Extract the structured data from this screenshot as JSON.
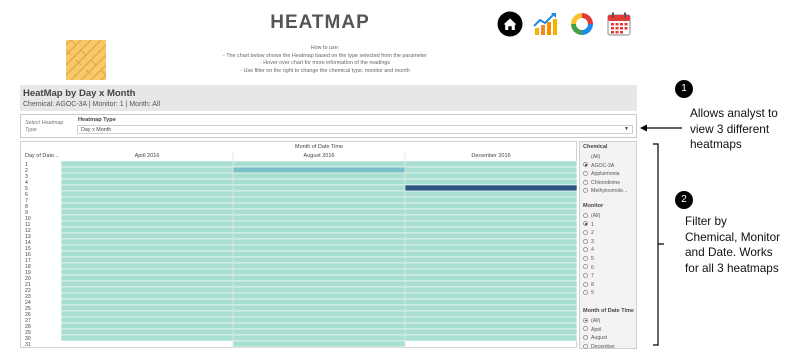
{
  "page": {
    "title": "HEATMAP",
    "how_to": [
      "How to use:",
      "- The chart below shows the  Heatmap based on the type selected from the parameter",
      "- Hover over chart for more information of the readings",
      "- Use filter on the right to change the chemical type, monitor and month"
    ]
  },
  "nav_icons": [
    "home-icon",
    "trend-chart-icon",
    "cycle-icon",
    "calendar-icon"
  ],
  "header": {
    "title": "HeatMap by Day x Month",
    "subtitle": "Chemical: AGOC-3A | Monitor: 1 | Month: All"
  },
  "parameter": {
    "side_label": [
      "Select Heatmap",
      "Type"
    ],
    "label": "Heatmap Type",
    "value": "Day x Month"
  },
  "chart": {
    "top_title": "Month of Date Time",
    "row_title": "Day of Date...",
    "columns": [
      "April 2016",
      "August 2016",
      "December 2016"
    ],
    "days": [
      "1",
      "2",
      "3",
      "4",
      "5",
      "6",
      "7",
      "8",
      "9",
      "10",
      "11",
      "12",
      "13",
      "14",
      "15",
      "16",
      "17",
      "18",
      "19",
      "20",
      "21",
      "22",
      "23",
      "24",
      "25",
      "26",
      "27",
      "28",
      "29",
      "30",
      "31"
    ],
    "colors": {
      "low": "#a9dfd1",
      "mid": "#79c0c8",
      "high": "#2c5583"
    }
  },
  "chart_data": {
    "type": "heatmap",
    "title": "Month of Date Time",
    "xlabel": "Month of Date Time",
    "ylabel": "Day of Date...",
    "x": [
      "April 2016",
      "August 2016",
      "December 2016"
    ],
    "y": [
      "1",
      "2",
      "3",
      "4",
      "5",
      "6",
      "7",
      "8",
      "9",
      "10",
      "11",
      "12",
      "13",
      "14",
      "15",
      "16",
      "17",
      "18",
      "19",
      "20",
      "21",
      "22",
      "23",
      "24",
      "25",
      "26",
      "27",
      "28",
      "29",
      "30",
      "31"
    ],
    "highlighted_cells": [
      {
        "column": "August 2016",
        "day": "2",
        "level": "mid"
      },
      {
        "column": "December 2016",
        "day": "5",
        "level": "high"
      }
    ],
    "empty_cells": [
      {
        "column": "April 2016",
        "day": "31"
      },
      {
        "column": "December 2016",
        "day": "31"
      }
    ],
    "default_level": "low"
  },
  "filters": {
    "chemical": {
      "title": "Chemical",
      "options": [
        {
          "label": "(All)",
          "selected": false,
          "has_radio": false
        },
        {
          "label": "AGOC-3A",
          "selected": true,
          "has_radio": true
        },
        {
          "label": "Appluimonia",
          "selected": false,
          "has_radio": true
        },
        {
          "label": "Chlorodinine",
          "selected": false,
          "has_radio": true
        },
        {
          "label": "Methylosmole...",
          "selected": false,
          "has_radio": true
        }
      ]
    },
    "monitor": {
      "title": "Monitor",
      "options": [
        {
          "label": "(All)",
          "selected": false,
          "has_radio": true
        },
        {
          "label": "1",
          "selected": true,
          "has_radio": true
        },
        {
          "label": "2",
          "selected": false,
          "has_radio": true
        },
        {
          "label": "3",
          "selected": false,
          "has_radio": true
        },
        {
          "label": "4",
          "selected": false,
          "has_radio": true
        },
        {
          "label": "5",
          "selected": false,
          "has_radio": true
        },
        {
          "label": "6",
          "selected": false,
          "has_radio": true
        },
        {
          "label": "7",
          "selected": false,
          "has_radio": true
        },
        {
          "label": "8",
          "selected": false,
          "has_radio": true
        },
        {
          "label": "9",
          "selected": false,
          "has_radio": true
        }
      ]
    },
    "month": {
      "title": "Month of Date Time",
      "options": [
        {
          "label": "(All)",
          "selected": true,
          "has_radio": true
        },
        {
          "label": "April",
          "selected": false,
          "has_radio": true
        },
        {
          "label": "August",
          "selected": false,
          "has_radio": true
        },
        {
          "label": "December",
          "selected": false,
          "has_radio": true
        }
      ]
    }
  },
  "callouts": [
    {
      "number": "1",
      "lines": [
        "Allows analyst to",
        "view 3 different",
        "heatmaps"
      ]
    },
    {
      "number": "2",
      "lines": [
        "Filter by",
        "Chemical, Monitor",
        "and Date. Works",
        "for all 3 heatmaps"
      ]
    }
  ]
}
